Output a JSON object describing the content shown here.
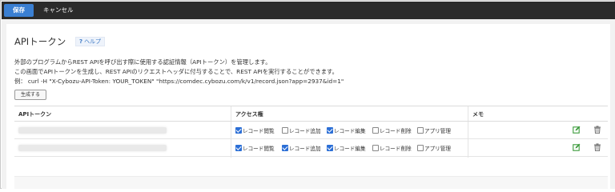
{
  "toolbar": {
    "save_label": "保存",
    "cancel_label": "キャンセル"
  },
  "page": {
    "title": "APIトークン",
    "help_label": "ヘルプ",
    "description": [
      "外部のプログラムからREST APIを呼び出す際に使用する認証情報（APIトークン）を管理します。",
      "この画面でAPIトークンを生成し、REST APIのリクエストヘッダに付与することで、REST APIを実行することができます。",
      "例： curl -H \"X-Cybozu-API-Token: YOUR_TOKEN\" \"https://comdec.cybozu.com/k/v1/record.json?app=2937&id=1\""
    ],
    "generate_label": "生成する"
  },
  "table": {
    "headers": {
      "token": "APIトークン",
      "access": "アクセス権",
      "memo": "メモ"
    },
    "permission_labels": [
      "レコード閲覧",
      "レコード追加",
      "レコード編集",
      "レコード削除",
      "アプリ管理"
    ],
    "rows": [
      {
        "token": "",
        "permissions": [
          true,
          false,
          true,
          false,
          false
        ],
        "memo": ""
      },
      {
        "token": "",
        "permissions": [
          true,
          true,
          true,
          false,
          false
        ],
        "memo": ""
      }
    ]
  },
  "colors": {
    "accent": "#3a7fd2",
    "topbar": "#2b2b2b",
    "checkbox_on": "#2c6fd6",
    "edit_icon": "#3a9a3a",
    "link": "#3b78c4"
  },
  "icons": {
    "help": "question-icon",
    "edit": "edit-icon",
    "delete": "trash-icon"
  }
}
